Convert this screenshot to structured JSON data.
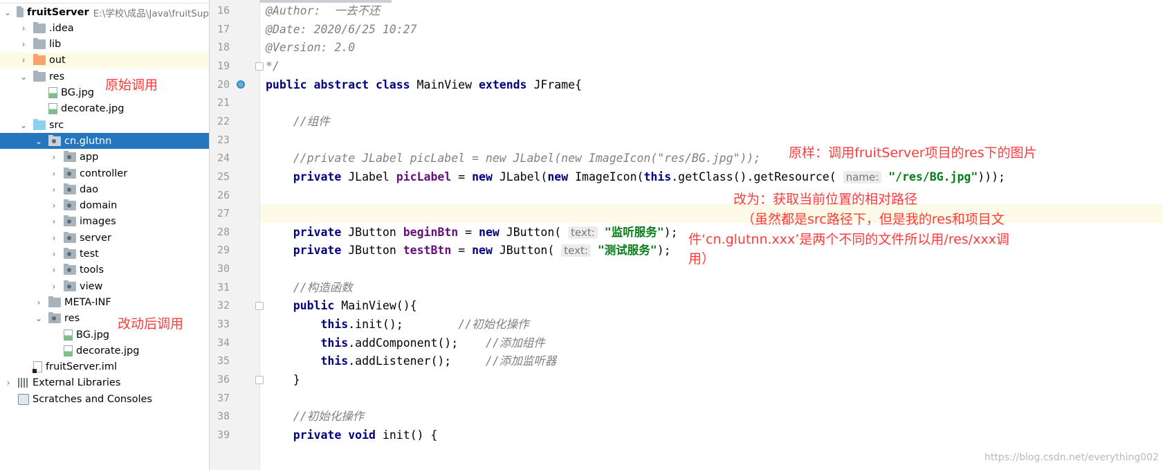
{
  "tree": {
    "items": [
      {
        "label": "fruitServer",
        "path": "E:\\学校\\成品\\Java\\fruitSup",
        "level": 0,
        "arrow": "down",
        "icon": "module-folder",
        "bold": true
      },
      {
        "label": ".idea",
        "level": 1,
        "arrow": "right",
        "icon": "folder"
      },
      {
        "label": "lib",
        "level": 1,
        "arrow": "right",
        "icon": "folder"
      },
      {
        "label": "out",
        "level": 1,
        "arrow": "right",
        "icon": "folder-orange",
        "highlight": true
      },
      {
        "label": "res",
        "level": 1,
        "arrow": "down",
        "icon": "folder"
      },
      {
        "label": "BG.jpg",
        "level": 2,
        "arrow": "",
        "icon": "image-file"
      },
      {
        "label": "decorate.jpg",
        "level": 2,
        "arrow": "",
        "icon": "image-file"
      },
      {
        "label": "src",
        "level": 1,
        "arrow": "down",
        "icon": "folder-blue"
      },
      {
        "label": "cn.glutnn",
        "level": 2,
        "arrow": "down",
        "icon": "package",
        "selected": true
      },
      {
        "label": "app",
        "level": 3,
        "arrow": "right",
        "icon": "package"
      },
      {
        "label": "controller",
        "level": 3,
        "arrow": "right",
        "icon": "package"
      },
      {
        "label": "dao",
        "level": 3,
        "arrow": "right",
        "icon": "package"
      },
      {
        "label": "domain",
        "level": 3,
        "arrow": "right",
        "icon": "package"
      },
      {
        "label": "images",
        "level": 3,
        "arrow": "right",
        "icon": "package"
      },
      {
        "label": "server",
        "level": 3,
        "arrow": "right",
        "icon": "package"
      },
      {
        "label": "test",
        "level": 3,
        "arrow": "right",
        "icon": "package"
      },
      {
        "label": "tools",
        "level": 3,
        "arrow": "right",
        "icon": "package"
      },
      {
        "label": "view",
        "level": 3,
        "arrow": "right",
        "icon": "package"
      },
      {
        "label": "META-INF",
        "level": 2,
        "arrow": "right",
        "icon": "folder"
      },
      {
        "label": "res",
        "level": 2,
        "arrow": "down",
        "icon": "package"
      },
      {
        "label": "BG.jpg",
        "level": 3,
        "arrow": "",
        "icon": "image-file"
      },
      {
        "label": "decorate.jpg",
        "level": 3,
        "arrow": "",
        "icon": "image-file"
      },
      {
        "label": "fruitServer.iml",
        "level": 1,
        "arrow": "",
        "icon": "iml-file"
      },
      {
        "label": "External Libraries",
        "level": 0,
        "arrow": "right",
        "icon": "library"
      },
      {
        "label": "Scratches and Consoles",
        "level": 0,
        "arrow": "",
        "icon": "scratches"
      }
    ]
  },
  "annotations": {
    "original": "原始调用",
    "modified": "改动后调用",
    "note1": "原样：调用fruitServer项目的res下的图片",
    "note2_l1": "改为：获取当前位置的相对路径",
    "note2_l2": "（虽然都是src路径下，但是我的res和项目文",
    "note2_l3": "件‘cn.glutnn.xxx’是两个不同的文件所以用/res/xxx调",
    "note2_l4": "用）",
    "color": "#ff3a3a"
  },
  "code": {
    "lines": [
      {
        "n": "16",
        "t": [
          [
            "cm",
            "@Author:  一去不还"
          ]
        ]
      },
      {
        "n": "17",
        "t": [
          [
            "cm",
            "@Date: 2020/6/25 10:27"
          ]
        ]
      },
      {
        "n": "18",
        "t": [
          [
            "cm",
            "@Version: 2.0"
          ]
        ]
      },
      {
        "n": "19",
        "t": [
          [
            "cm",
            "*/"
          ]
        ],
        "fold": true
      },
      {
        "n": "20",
        "t": [
          [
            "kw",
            "public abstract class "
          ],
          [
            "",
            "MainView "
          ],
          [
            "kw",
            "extends "
          ],
          [
            "",
            "JFrame{"
          ]
        ],
        "marker": "implemented-icon"
      },
      {
        "n": "21",
        "t": []
      },
      {
        "n": "22",
        "t": [
          [
            "",
            "    "
          ],
          [
            "cm",
            "//组件"
          ]
        ]
      },
      {
        "n": "23",
        "t": []
      },
      {
        "n": "24",
        "t": [
          [
            "",
            "    "
          ],
          [
            "cm",
            "//private JLabel picLabel = new JLabel(new ImageIcon(\"res/BG.jpg\"));"
          ]
        ]
      },
      {
        "n": "25",
        "t": [
          [
            "",
            "    "
          ],
          [
            "kw",
            "private "
          ],
          [
            "",
            "JLabel "
          ],
          [
            "fld",
            "picLabel"
          ],
          [
            "",
            " = "
          ],
          [
            "kw",
            "new "
          ],
          [
            "",
            "JLabel("
          ],
          [
            "kw",
            "new "
          ],
          [
            "",
            "ImageIcon("
          ],
          [
            "kw",
            "this"
          ],
          [
            "",
            ".getClass().getResource( "
          ],
          [
            "hint",
            "name:"
          ],
          [
            "",
            " "
          ],
          [
            "str",
            "\"/res/BG.jpg\""
          ],
          [
            "",
            ")));"
          ]
        ]
      },
      {
        "n": "26",
        "t": []
      },
      {
        "n": "27",
        "t": [],
        "highlight": true
      },
      {
        "n": "28",
        "t": [
          [
            "",
            "    "
          ],
          [
            "kw",
            "private "
          ],
          [
            "",
            "JButton "
          ],
          [
            "fld",
            "beginBtn"
          ],
          [
            "",
            " = "
          ],
          [
            "kw",
            "new "
          ],
          [
            "",
            "JButton( "
          ],
          [
            "hint",
            "text:"
          ],
          [
            "",
            " "
          ],
          [
            "str",
            "\"监听服务\""
          ],
          [
            "",
            ");"
          ]
        ]
      },
      {
        "n": "29",
        "t": [
          [
            "",
            "    "
          ],
          [
            "kw",
            "private "
          ],
          [
            "",
            "JButton "
          ],
          [
            "fld",
            "testBtn"
          ],
          [
            "",
            " = "
          ],
          [
            "kw",
            "new "
          ],
          [
            "",
            "JButton( "
          ],
          [
            "hint",
            "text:"
          ],
          [
            "",
            " "
          ],
          [
            "str",
            "\"测试服务\""
          ],
          [
            "",
            ");"
          ]
        ]
      },
      {
        "n": "30",
        "t": []
      },
      {
        "n": "31",
        "t": [
          [
            "",
            "    "
          ],
          [
            "cm",
            "//构造函数"
          ]
        ]
      },
      {
        "n": "32",
        "t": [
          [
            "",
            "    "
          ],
          [
            "kw",
            "public "
          ],
          [
            "",
            "MainView(){"
          ]
        ],
        "fold": true
      },
      {
        "n": "33",
        "t": [
          [
            "",
            "        "
          ],
          [
            "kw",
            "this"
          ],
          [
            "",
            ".init();        "
          ],
          [
            "cm",
            "//初始化操作"
          ]
        ]
      },
      {
        "n": "34",
        "t": [
          [
            "",
            "        "
          ],
          [
            "kw",
            "this"
          ],
          [
            "",
            ".addComponent();    "
          ],
          [
            "cm",
            "//添加组件"
          ]
        ]
      },
      {
        "n": "35",
        "t": [
          [
            "",
            "        "
          ],
          [
            "kw",
            "this"
          ],
          [
            "",
            ".addListener();     "
          ],
          [
            "cm",
            "//添加监听器"
          ]
        ]
      },
      {
        "n": "36",
        "t": [
          [
            "",
            "    }"
          ]
        ],
        "fold": true
      },
      {
        "n": "37",
        "t": []
      },
      {
        "n": "38",
        "t": [
          [
            "",
            "    "
          ],
          [
            "cm",
            "//初始化操作"
          ]
        ]
      },
      {
        "n": "39",
        "t": [
          [
            "",
            "    "
          ],
          [
            "kw",
            "private void "
          ],
          [
            "",
            "init() {"
          ]
        ]
      }
    ]
  },
  "watermark": "https://blog.csdn.net/everything002"
}
